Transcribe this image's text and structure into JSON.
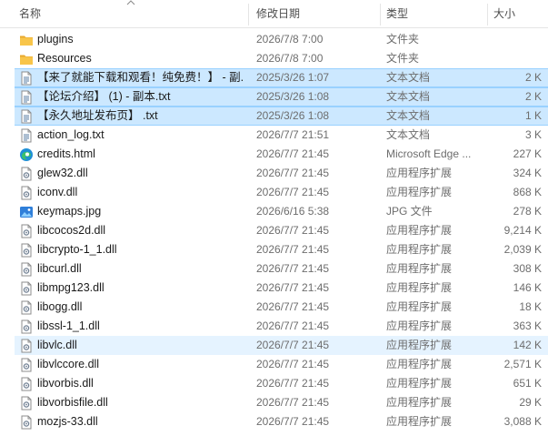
{
  "header": {
    "name": "名称",
    "date": "修改日期",
    "type": "类型",
    "size": "大小"
  },
  "files": [
    {
      "name": "plugins",
      "date": "2026/7/8 7:00",
      "type": "文件夹",
      "size": "",
      "icon": "folder-icon",
      "state": ""
    },
    {
      "name": "Resources",
      "date": "2026/7/8 7:00",
      "type": "文件夹",
      "size": "",
      "icon": "folder-icon",
      "state": ""
    },
    {
      "name": "【来了就能下载和观看！纯免费！】 - 副...",
      "date": "2025/3/26 1:07",
      "type": "文本文档",
      "size": "2 K",
      "icon": "text-file-icon",
      "state": "selected"
    },
    {
      "name": "【论坛介绍】 (1) - 副本.txt",
      "date": "2025/3/26 1:08",
      "type": "文本文档",
      "size": "2 K",
      "icon": "text-file-icon",
      "state": "selected"
    },
    {
      "name": "【永久地址发布页】 .txt",
      "date": "2025/3/26 1:08",
      "type": "文本文档",
      "size": "1 K",
      "icon": "text-file-icon",
      "state": "selected"
    },
    {
      "name": "action_log.txt",
      "date": "2026/7/7 21:51",
      "type": "文本文档",
      "size": "3 K",
      "icon": "text-file-icon",
      "state": ""
    },
    {
      "name": "credits.html",
      "date": "2026/7/7 21:45",
      "type": "Microsoft Edge ...",
      "size": "227 K",
      "icon": "edge-html-icon",
      "state": ""
    },
    {
      "name": "glew32.dll",
      "date": "2026/7/7 21:45",
      "type": "应用程序扩展",
      "size": "324 K",
      "icon": "dll-file-icon",
      "state": ""
    },
    {
      "name": "iconv.dll",
      "date": "2026/7/7 21:45",
      "type": "应用程序扩展",
      "size": "868 K",
      "icon": "dll-file-icon",
      "state": ""
    },
    {
      "name": "keymaps.jpg",
      "date": "2026/6/16 5:38",
      "type": "JPG 文件",
      "size": "278 K",
      "icon": "image-file-icon",
      "state": ""
    },
    {
      "name": "libcocos2d.dll",
      "date": "2026/7/7 21:45",
      "type": "应用程序扩展",
      "size": "9,214 K",
      "icon": "dll-file-icon",
      "state": ""
    },
    {
      "name": "libcrypto-1_1.dll",
      "date": "2026/7/7 21:45",
      "type": "应用程序扩展",
      "size": "2,039 K",
      "icon": "dll-file-icon",
      "state": ""
    },
    {
      "name": "libcurl.dll",
      "date": "2026/7/7 21:45",
      "type": "应用程序扩展",
      "size": "308 K",
      "icon": "dll-file-icon",
      "state": ""
    },
    {
      "name": "libmpg123.dll",
      "date": "2026/7/7 21:45",
      "type": "应用程序扩展",
      "size": "146 K",
      "icon": "dll-file-icon",
      "state": ""
    },
    {
      "name": "libogg.dll",
      "date": "2026/7/7 21:45",
      "type": "应用程序扩展",
      "size": "18 K",
      "icon": "dll-file-icon",
      "state": ""
    },
    {
      "name": "libssl-1_1.dll",
      "date": "2026/7/7 21:45",
      "type": "应用程序扩展",
      "size": "363 K",
      "icon": "dll-file-icon",
      "state": ""
    },
    {
      "name": "libvlc.dll",
      "date": "2026/7/7 21:45",
      "type": "应用程序扩展",
      "size": "142 K",
      "icon": "dll-file-icon",
      "state": "hover"
    },
    {
      "name": "libvlccore.dll",
      "date": "2026/7/7 21:45",
      "type": "应用程序扩展",
      "size": "2,571 K",
      "icon": "dll-file-icon",
      "state": ""
    },
    {
      "name": "libvorbis.dll",
      "date": "2026/7/7 21:45",
      "type": "应用程序扩展",
      "size": "651 K",
      "icon": "dll-file-icon",
      "state": ""
    },
    {
      "name": "libvorbisfile.dll",
      "date": "2026/7/7 21:45",
      "type": "应用程序扩展",
      "size": "29 K",
      "icon": "dll-file-icon",
      "state": ""
    },
    {
      "name": "mozjs-33.dll",
      "date": "2026/7/7 21:45",
      "type": "应用程序扩展",
      "size": "3,088 K",
      "icon": "dll-file-icon",
      "state": ""
    }
  ],
  "colors": {
    "selection": "#cce8ff",
    "selection_border": "#99d1ff",
    "hover": "#e5f3ff",
    "folder": "#f8c54a"
  }
}
